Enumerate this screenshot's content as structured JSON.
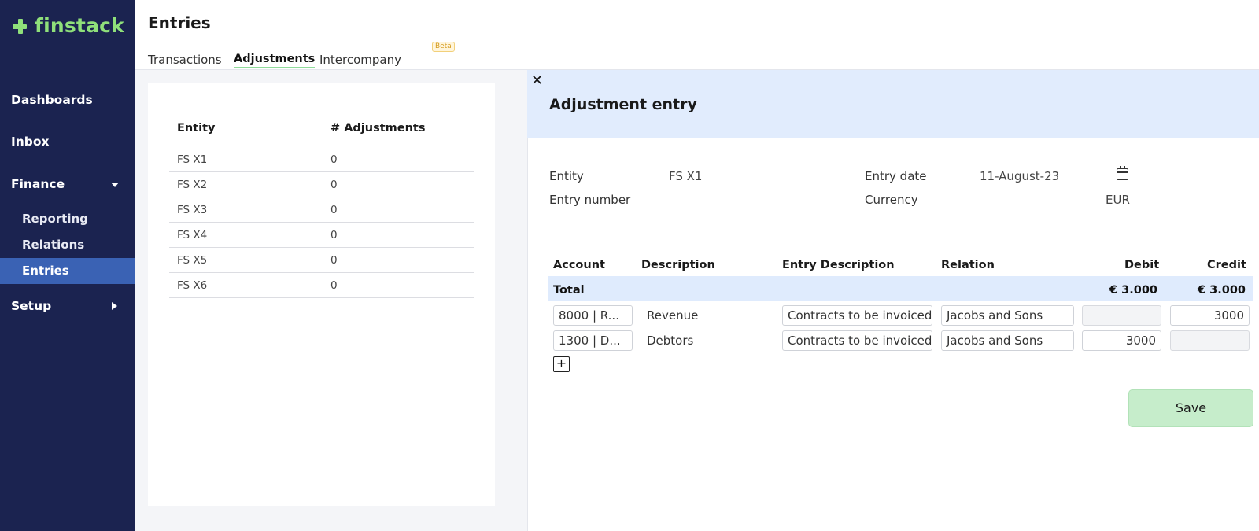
{
  "app": {
    "name": "finstack"
  },
  "sidebar": {
    "dashboards": "Dashboards",
    "inbox": "Inbox",
    "finance": "Finance",
    "reporting": "Reporting",
    "relations": "Relations",
    "entries": "Entries",
    "setup": "Setup"
  },
  "header": {
    "title": "Entries",
    "tabs": [
      "Transactions",
      "Adjustments",
      "Intercompany"
    ],
    "beta": "Beta"
  },
  "entity_table": {
    "headers": [
      "Entity",
      "# Adjustments"
    ],
    "rows": [
      {
        "entity": "FS X1",
        "count": "0"
      },
      {
        "entity": "FS X2",
        "count": "0"
      },
      {
        "entity": "FS X3",
        "count": "0"
      },
      {
        "entity": "FS X4",
        "count": "0"
      },
      {
        "entity": "FS X5",
        "count": "0"
      },
      {
        "entity": "FS X6",
        "count": "0"
      }
    ]
  },
  "panel": {
    "close": "✕",
    "title": "Adjustment entry",
    "entity_label": "Entity",
    "entity_value": "FS X1",
    "entry_number_label": "Entry number",
    "entry_date_label": "Entry date",
    "entry_date_value": "11-August-23",
    "currency_label": "Currency",
    "currency_value": "EUR",
    "headers": [
      "Account",
      "Description",
      "Entry Description",
      "Relation",
      "Debit",
      "Credit"
    ],
    "total": {
      "label": "Total",
      "debit": "€ 3.000",
      "credit": "€ 3.000"
    },
    "lines": [
      {
        "account": "8000 | R...",
        "description": "Revenue",
        "entry_description": "Contracts to be invoiced",
        "relation": "Jacobs and Sons",
        "debit": "",
        "credit": "3000"
      },
      {
        "account": "1300 | D...",
        "description": "Debtors",
        "entry_description": "Contracts to be invoiced",
        "relation": "Jacobs and Sons",
        "debit": "3000",
        "credit": ""
      }
    ],
    "add": "+",
    "save": "Save"
  },
  "colors": {
    "sidebar_bg": "#1b2350",
    "active_nav": "#3a62b4",
    "brand_green": "#8fe07a",
    "panel_header": "#e1ecfd",
    "save_bg": "#c6edcb"
  }
}
